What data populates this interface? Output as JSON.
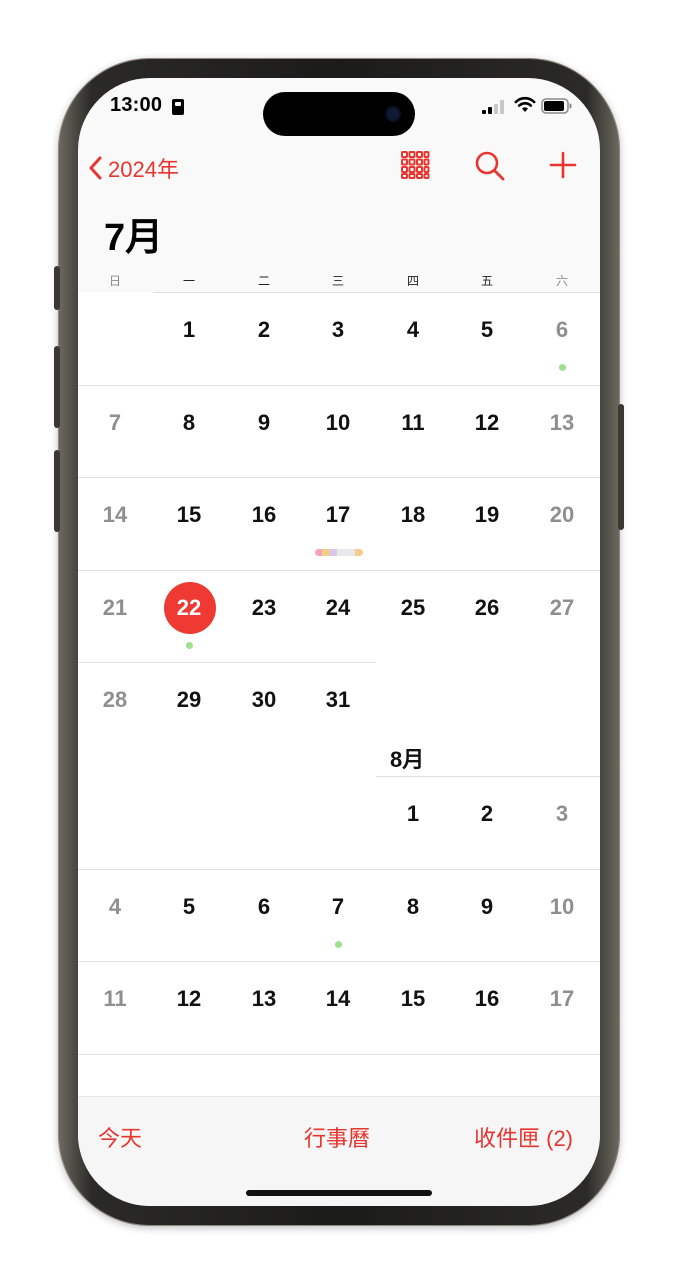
{
  "status": {
    "time": "13:00"
  },
  "nav": {
    "back_label": "2024年"
  },
  "calendar": {
    "title": "7月",
    "weekdays": [
      "日",
      "一",
      "二",
      "三",
      "四",
      "五",
      "六"
    ],
    "july_days": [
      "1",
      "2",
      "3",
      "4",
      "5",
      "6",
      "7",
      "8",
      "9",
      "10",
      "11",
      "12",
      "13",
      "14",
      "15",
      "16",
      "17",
      "18",
      "19",
      "20",
      "21",
      "22",
      "23",
      "24",
      "25",
      "26",
      "27",
      "28",
      "29",
      "30",
      "31"
    ],
    "august_label": "8月",
    "august_days": [
      "1",
      "2",
      "3",
      "4",
      "5",
      "6",
      "7",
      "8",
      "9",
      "10",
      "11",
      "12",
      "13",
      "14",
      "15",
      "16",
      "17"
    ],
    "today": "22",
    "event_dots": [
      "7/6",
      "7/22",
      "8/7"
    ],
    "multi_event_day": "7/17",
    "accent_color": "#ef3a33",
    "dot_color": "#9ee08d"
  },
  "tabbar": {
    "today": "今天",
    "calendars": "行事曆",
    "inbox": "收件匣 (2)"
  }
}
